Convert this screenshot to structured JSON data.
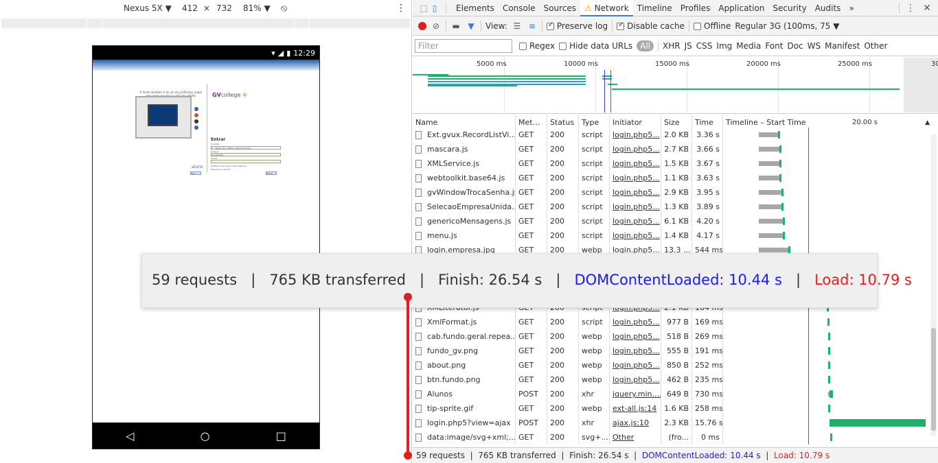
{
  "device_toolbar": {
    "device": "Nexus 5X ▼",
    "width": "412",
    "times": "×",
    "height": "732",
    "zoom": "81% ▼",
    "rotate_icon": "rotate-icon",
    "more_icon": "vertical-dots-icon"
  },
  "phone": {
    "time": "12:29",
    "login_page": {
      "tagline": "A fonte também é de um de profissões pagar em correr escolar e carta de crédito",
      "brand": "GV",
      "brand_suffix": "college",
      "entrar": "Entrar",
      "unidade_label": "Unidade",
      "unidade_value": "0 - SENAC RS | SENAC CAXIAS DO SUL",
      "usuario_label": "Usuário",
      "usuario_value": "123456789",
      "senha_label": "Senha",
      "remember": "Lembrar meu login nesta máquina",
      "forgot": "Esqueceu a senha?",
      "aluno": "aluno",
      "sair": "Sair",
      "entrar_btn": "Entrar"
    }
  },
  "devtools": {
    "tabs": [
      "Elements",
      "Console",
      "Sources",
      "Network",
      "Timeline",
      "Profiles",
      "Application",
      "Security",
      "Audits"
    ],
    "active_tab": "Network",
    "warning_icon": "warning-triangle-icon",
    "more_tabs": "»",
    "toolbar": {
      "view_label": "View:",
      "preserve_log": "Preserve log",
      "disable_cache": "Disable cache",
      "offline": "Offline",
      "throttle": "Regular 3G (100ms, 75 ▼"
    },
    "filter": {
      "placeholder": "Filter",
      "regex": "Regex",
      "hide_data_urls": "Hide data URLs",
      "types": [
        "All",
        "XHR",
        "JS",
        "CSS",
        "Img",
        "Media",
        "Font",
        "Doc",
        "WS",
        "Manifest",
        "Other"
      ]
    },
    "overview_ticks": [
      "5000 ms",
      "10000 ms",
      "15000 ms",
      "20000 ms",
      "25000 ms",
      "30"
    ],
    "columns": {
      "name": "Name",
      "method": "Met…",
      "status": "Status",
      "type": "Type",
      "initiator": "Initiator",
      "size": "Size",
      "time": "Time",
      "timeline": "Timeline – Start Time",
      "timeline_tick": "20.00 s"
    },
    "rows_top": [
      {
        "name": "Ext.gvux.RecordListVi...",
        "method": "GET",
        "status": "200",
        "type": "script",
        "initiator": "login.php5...",
        "size": "2.0 KB",
        "time": "3.36 s",
        "start": 3.5,
        "wait": 3.2,
        "recv": 0.2
      },
      {
        "name": "mascara.js",
        "method": "GET",
        "status": "200",
        "type": "script",
        "initiator": "login.php5...",
        "size": "2.7 KB",
        "time": "3.66 s",
        "start": 3.5,
        "wait": 3.4,
        "recv": 0.25
      },
      {
        "name": "XMLService.js",
        "method": "GET",
        "status": "200",
        "type": "script",
        "initiator": "login.php5...",
        "size": "1.5 KB",
        "time": "3.67 s",
        "start": 3.5,
        "wait": 3.4,
        "recv": 0.25
      },
      {
        "name": "webtoolkit.base64.js",
        "method": "GET",
        "status": "200",
        "type": "script",
        "initiator": "login.php5...",
        "size": "1.1 KB",
        "time": "3.63 s",
        "start": 3.5,
        "wait": 3.4,
        "recv": 0.2
      },
      {
        "name": "gvWindowTrocaSenha.js",
        "method": "GET",
        "status": "200",
        "type": "script",
        "initiator": "login.php5...",
        "size": "2.9 KB",
        "time": "3.95 s",
        "start": 3.5,
        "wait": 3.7,
        "recv": 0.25
      },
      {
        "name": "SelecaoEmpresaUnida...",
        "method": "GET",
        "status": "200",
        "type": "script",
        "initiator": "login.php5...",
        "size": "1.3 KB",
        "time": "3.89 s",
        "start": 3.5,
        "wait": 3.7,
        "recv": 0.2
      },
      {
        "name": "genericoMensagens.js",
        "method": "GET",
        "status": "200",
        "type": "script",
        "initiator": "login.php5...",
        "size": "6.1 KB",
        "time": "4.20 s",
        "start": 3.5,
        "wait": 3.9,
        "recv": 0.3
      },
      {
        "name": "menu.js",
        "method": "GET",
        "status": "200",
        "type": "script",
        "initiator": "login.php5...",
        "size": "1.4 KB",
        "time": "4.17 s",
        "start": 3.5,
        "wait": 3.9,
        "recv": 0.3
      },
      {
        "name": "login.empresa.jpg",
        "method": "GET",
        "status": "200",
        "type": "webp",
        "initiator": "login.php5...",
        "size": "13.3 ...",
        "time": "544 ms",
        "start": 3.5,
        "wait": 4.8,
        "recv": 0.3
      }
    ],
    "rows_bottom": [
      {
        "name": "XMLIterator.js",
        "method": "GET",
        "status": "200",
        "type": "script",
        "initiator": "login.php5...",
        "size": "2.1 KB",
        "time": "164 ms",
        "start": 14.6,
        "wait": 0,
        "recv": 0.15
      },
      {
        "name": "XmlFormat.js",
        "method": "GET",
        "status": "200",
        "type": "script",
        "initiator": "login.php5...",
        "size": "977 B",
        "time": "169 ms",
        "start": 14.7,
        "wait": 0,
        "recv": 0.15
      },
      {
        "name": "cab.fundo.geral.repea...",
        "method": "GET",
        "status": "200",
        "type": "webp",
        "initiator": "login.php5...",
        "size": "518 B",
        "time": "269 ms",
        "start": 14.8,
        "wait": 0,
        "recv": 0.25
      },
      {
        "name": "fundo_gv.png",
        "method": "GET",
        "status": "200",
        "type": "webp",
        "initiator": "login.php5...",
        "size": "555 B",
        "time": "191 ms",
        "start": 14.8,
        "wait": 0,
        "recv": 0.2
      },
      {
        "name": "about.png",
        "method": "GET",
        "status": "200",
        "type": "webp",
        "initiator": "login.php5...",
        "size": "850 B",
        "time": "252 ms",
        "start": 14.8,
        "wait": 0,
        "recv": 0.2
      },
      {
        "name": "btn.fundo.png",
        "method": "GET",
        "status": "200",
        "type": "webp",
        "initiator": "login.php5...",
        "size": "462 B",
        "time": "235 ms",
        "start": 14.8,
        "wait": 0,
        "recv": 0.2
      },
      {
        "name": "Alunos",
        "method": "POST",
        "status": "200",
        "type": "xhr",
        "initiator": "jquery.min....",
        "size": "649 B",
        "time": "730 ms",
        "start": 14.8,
        "wait": 0.2,
        "recv": 0.5
      },
      {
        "name": "tip-sprite.gif",
        "method": "GET",
        "status": "200",
        "type": "webp",
        "initiator": "ext-all.js:14",
        "size": "1.6 KB",
        "time": "258 ms",
        "start": 14.8,
        "wait": 0,
        "recv": 0.25
      },
      {
        "name": "login.php5?view=ajax",
        "method": "POST",
        "status": "200",
        "type": "xhr",
        "initiator": "ajax.js:10",
        "size": "2.3 KB",
        "time": "15.76 s",
        "start": 15.0,
        "wait": 0,
        "recv": 15.6
      },
      {
        "name": "data:image/svg+xml;...",
        "method": "GET",
        "status": "200",
        "type": "svg+...",
        "initiator": "Other",
        "size": "(fro...",
        "time": "0 ms",
        "start": 15.1,
        "wait": 0,
        "recv": 0.15
      }
    ],
    "summary": {
      "requests": "59 requests",
      "transferred": "765 KB transferred",
      "finish": "Finish: 26.54 s",
      "dcl": "DOMContentLoaded: 10.44 s",
      "load": "Load: 10.79 s",
      "sep": "|"
    },
    "colors": {
      "accent": "#3879d9",
      "dcl": "#1a1aff",
      "load": "#e61f1f",
      "receiving": "#18b568",
      "waiting": "#a7a7a7"
    }
  }
}
